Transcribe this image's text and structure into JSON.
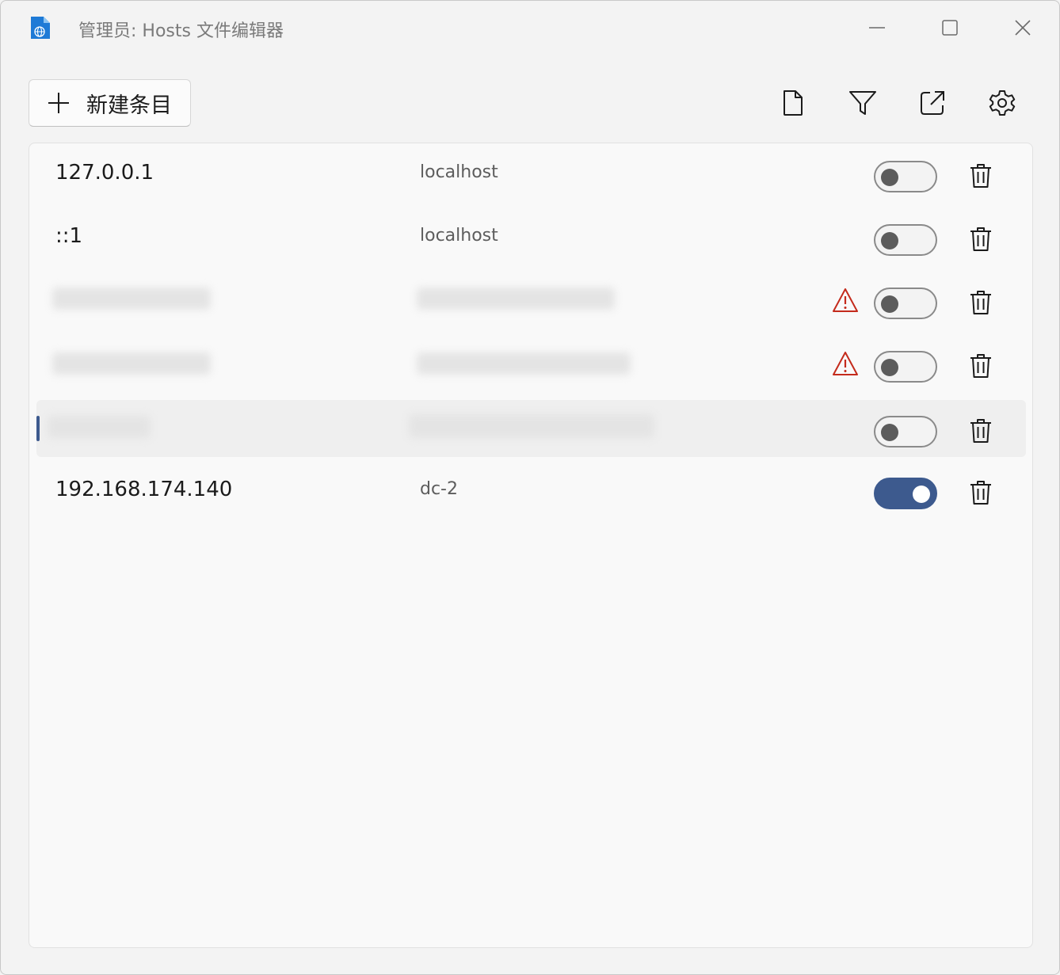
{
  "window": {
    "title": "管理员: Hosts 文件编辑器",
    "app_icon": "hosts-file-globe-icon"
  },
  "toolbar": {
    "new_entry_label": "新建条目",
    "icons": [
      "open-hosts-file-icon",
      "filter-icon",
      "open-external-icon",
      "settings-icon"
    ]
  },
  "entries": [
    {
      "ip": "127.0.0.1",
      "hosts": "localhost",
      "active": false,
      "warning": false,
      "redacted": false,
      "selected": false
    },
    {
      "ip": "::1",
      "hosts": "localhost",
      "active": false,
      "warning": false,
      "redacted": false,
      "selected": false
    },
    {
      "ip": "",
      "hosts": "",
      "active": false,
      "warning": true,
      "redacted": true,
      "selected": false
    },
    {
      "ip": "",
      "hosts": "",
      "active": false,
      "warning": true,
      "redacted": true,
      "selected": false
    },
    {
      "ip": "",
      "hosts": "",
      "active": false,
      "warning": false,
      "redacted": true,
      "selected": true
    },
    {
      "ip": "192.168.174.140",
      "hosts": "dc-2",
      "active": true,
      "warning": false,
      "redacted": false,
      "selected": false
    }
  ],
  "colors": {
    "accent": "#3d5a8e",
    "warning": "#c42b1c"
  }
}
